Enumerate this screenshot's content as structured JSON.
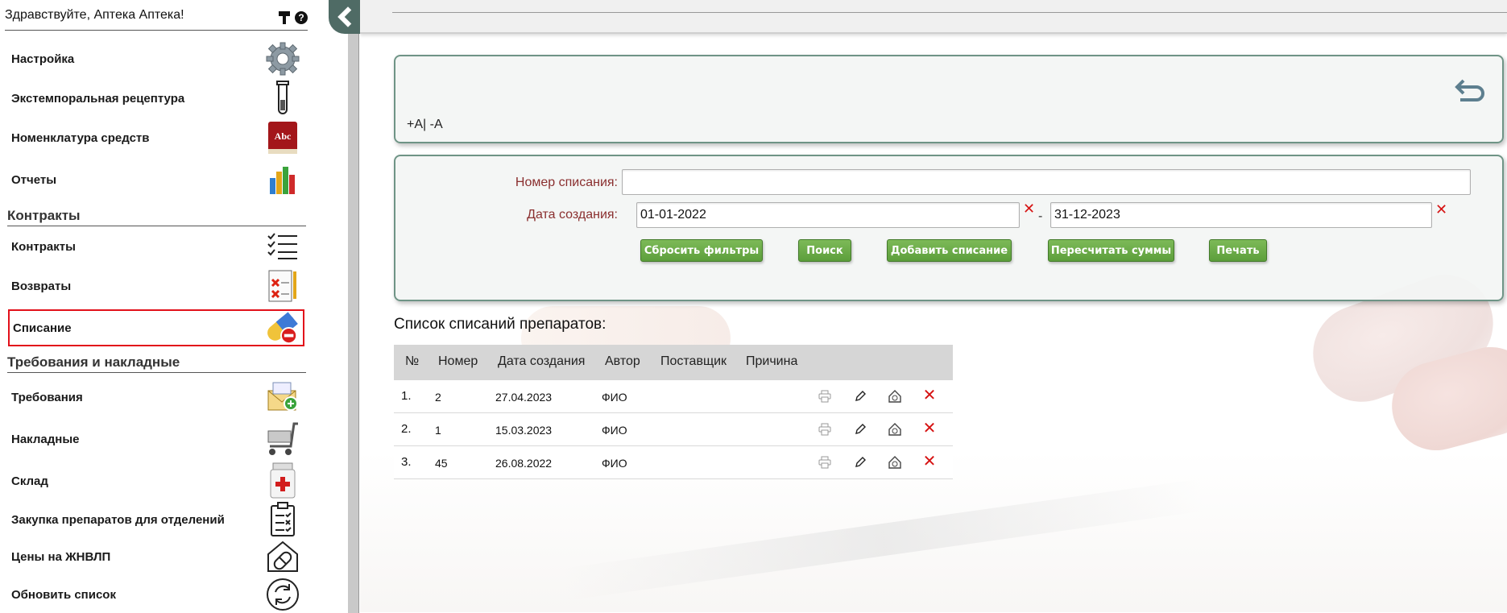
{
  "sidebar": {
    "greeting": "Здравствуйте, Аптека Аптека!",
    "help_icon": "question-icon",
    "sections": {
      "contracts": "Контракты",
      "requirements": "Требования и накладные"
    },
    "items": [
      {
        "label": "Настройка",
        "icon": "gear-icon"
      },
      {
        "label": "Экстемпоральная рецептура",
        "icon": "test-tube-icon"
      },
      {
        "label": "Номенклатура средств",
        "icon": "book-icon"
      },
      {
        "label": "Отчеты",
        "icon": "bar-chart-icon"
      },
      {
        "label": "Контракты",
        "icon": "checklist-icon"
      },
      {
        "label": "Возвраты",
        "icon": "return-doc-icon"
      },
      {
        "label": "Списание",
        "icon": "pill-remove-icon"
      },
      {
        "label": "Требования",
        "icon": "envelope-icon"
      },
      {
        "label": "Накладные",
        "icon": "cart-icon"
      },
      {
        "label": "Склад",
        "icon": "medicine-jar-icon"
      },
      {
        "label": "Закупка препаратов для отделений",
        "icon": "clipboard-icon"
      },
      {
        "label": "Цены на ЖНВЛП",
        "icon": "house-pill-icon"
      },
      {
        "label": "Обновить список",
        "icon": "refresh-icon"
      }
    ],
    "active_item": "Списание"
  },
  "toolbar": {
    "font_size_label": "+A| -A"
  },
  "filters": {
    "number_label": "Номер списания:",
    "number_value": "",
    "date_label": "Дата создания:",
    "date_from": "01-01-2022",
    "date_to": "31-12-2023",
    "date_separator": "-",
    "clear_mark": "✕"
  },
  "buttons": {
    "reset": "Сбросить фильтры",
    "search": "Поиск",
    "add": "Добавить списание",
    "recalc": "Пересчитать суммы",
    "print": "Печать"
  },
  "list": {
    "title": "Список списаний препаратов:",
    "columns": [
      "№",
      "Номер",
      "Дата создания",
      "Автор",
      "Поставщик",
      "Причина"
    ],
    "rows": [
      {
        "index": "1.",
        "number": "2",
        "date": "27.04.2023",
        "author": "ФИО",
        "supplier": "",
        "reason": ""
      },
      {
        "index": "2.",
        "number": "1",
        "date": "15.03.2023",
        "author": "ФИО",
        "supplier": "",
        "reason": ""
      },
      {
        "index": "3.",
        "number": "45",
        "date": "26.08.2022",
        "author": "ФИО",
        "supplier": "",
        "reason": ""
      }
    ],
    "delete_mark": "✕"
  },
  "colors": {
    "accent_green": "#5c9e3b",
    "panel_border": "#6f9486",
    "active_border": "#e2101a",
    "delete_red": "#d61313",
    "label_red": "#8a2f2f"
  }
}
